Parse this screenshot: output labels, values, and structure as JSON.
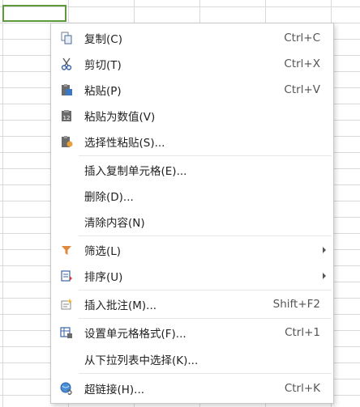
{
  "context_menu": {
    "items": [
      {
        "label": "复制(C)",
        "shortcut": "Ctrl+C",
        "icon": "copy-icon"
      },
      {
        "label": "剪切(T)",
        "shortcut": "Ctrl+X",
        "icon": "scissors-icon"
      },
      {
        "label": "粘贴(P)",
        "shortcut": "Ctrl+V",
        "icon": "paste-icon"
      },
      {
        "label": "粘贴为数值(V)",
        "shortcut": "",
        "icon": "paste-values-icon"
      },
      {
        "label": "选择性粘贴(S)...",
        "shortcut": "",
        "icon": "paste-special-icon"
      },
      {
        "label": "插入复制单元格(E)...",
        "shortcut": "",
        "icon": ""
      },
      {
        "label": "删除(D)...",
        "shortcut": "",
        "icon": ""
      },
      {
        "label": "清除内容(N)",
        "shortcut": "",
        "icon": ""
      },
      {
        "label": "筛选(L)",
        "shortcut": "",
        "icon": "filter-icon",
        "submenu": true
      },
      {
        "label": "排序(U)",
        "shortcut": "",
        "icon": "sort-icon",
        "submenu": true
      },
      {
        "label": "插入批注(M)...",
        "shortcut": "Shift+F2",
        "icon": "comment-icon"
      },
      {
        "label": "设置单元格格式(F)...",
        "shortcut": "Ctrl+1",
        "icon": "format-cells-icon"
      },
      {
        "label": "从下拉列表中选择(K)...",
        "shortcut": "",
        "icon": ""
      },
      {
        "label": "超链接(H)...",
        "shortcut": "Ctrl+K",
        "icon": "hyperlink-icon"
      }
    ]
  },
  "colors": {
    "active_cell_border": "#5c9a3b",
    "grid_line": "#d9d9d9",
    "menu_border": "#c8c8c8"
  }
}
